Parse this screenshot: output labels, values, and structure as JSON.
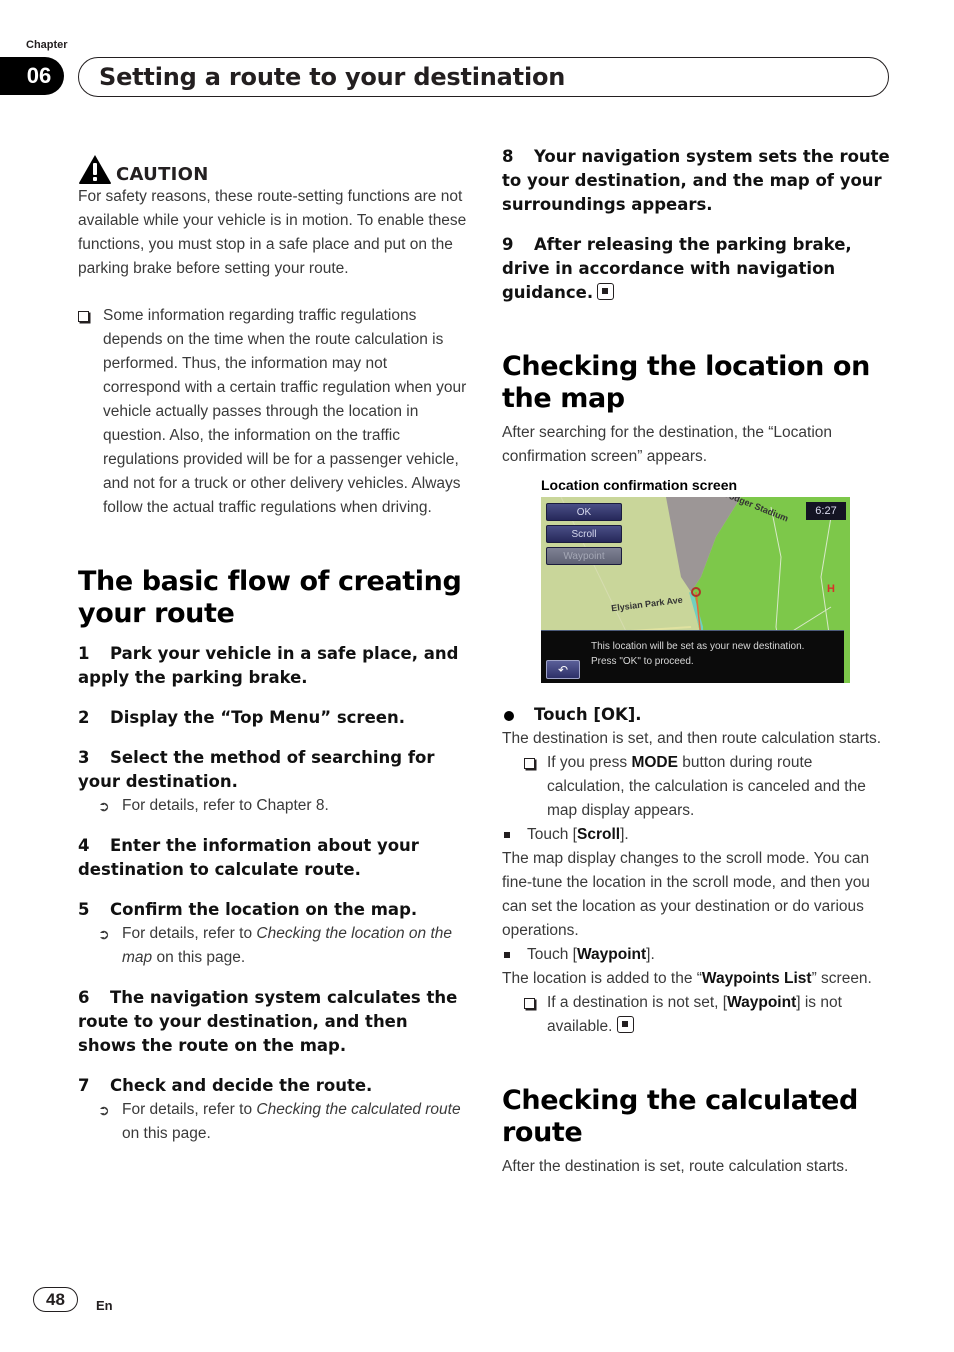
{
  "header": {
    "chapter_label": "Chapter",
    "chapter_number": "06",
    "chapter_title": "Setting a route to your destination"
  },
  "caution": {
    "icon": "warning-triangle-icon",
    "label": "CAUTION",
    "text": "For safety reasons, these route-setting functions are not available while your vehicle is in motion. To enable these functions, you must stop in a safe place and put on the parking brake before setting your route."
  },
  "traffic_note": "Some information regarding traffic regulations depends on the time when the route calculation is performed. Thus, the information may not correspond with a certain traffic regulation when your vehicle actually passes through the location in question. Also, the information on the traffic regulations provided will be for a passenger vehicle, and not for a truck or other delivery vehicles. Always follow the actual traffic regulations when driving.",
  "basic_flow": {
    "heading": "The basic flow of creating your route",
    "steps": [
      {
        "num": "1",
        "text": "Park your vehicle in a safe place, and apply the parking brake."
      },
      {
        "num": "2",
        "text": "Display the “Top Menu” screen."
      },
      {
        "num": "3",
        "text": "Select the method of searching for your destination.",
        "ref": "For details, refer to Chapter 8."
      },
      {
        "num": "4",
        "text": "Enter the information about your destination to calculate route."
      },
      {
        "num": "5",
        "text": "Confirm the location on the map.",
        "ref_prefix": "For details, refer to ",
        "ref_italic": "Checking the location on the map",
        "ref_suffix": " on this page."
      },
      {
        "num": "6",
        "text": "The navigation system calculates the route to your destination, and then shows the route on the map."
      },
      {
        "num": "7",
        "text": "Check and decide the route.",
        "ref_prefix": "For details, refer to ",
        "ref_italic": "Checking the calculated route",
        "ref_suffix": " on this page."
      },
      {
        "num": "8",
        "text": "Your navigation system sets the route to your destination, and the map of your surroundings appears."
      },
      {
        "num": "9",
        "text": "After releasing the parking brake, drive in accordance with navigation guidance."
      }
    ]
  },
  "check_location": {
    "heading": "Checking the location on the map",
    "intro": "After searching for the destination, the “Location confirmation screen” appears.",
    "figure_caption": "Location confirmation screen",
    "screen": {
      "buttons": [
        "OK",
        "Scroll",
        "Waypoint"
      ],
      "clock": "6:27",
      "street": "Elysian Park Ave",
      "landmark": "Dodger Stadium",
      "message_line1": "This location will be set as your new destination.",
      "message_line2": "Press \"OK\" to proceed.",
      "back_icon": "back-arrow-icon"
    },
    "touch_ok": {
      "label": "Touch [OK].",
      "result": "The destination is set, and then route calculation starts.",
      "note_prefix": "If you press ",
      "note_bold": "MODE",
      "note_suffix": " button during route calculation, the calculation is canceled and the map display appears."
    },
    "touch_scroll": {
      "prefix": "Touch [",
      "bold": "Scroll",
      "suffix": "].",
      "result": "The map display changes to the scroll mode. You can fine-tune the location in the scroll mode, and then you can set the location as your destination or do various operations."
    },
    "touch_waypoint": {
      "prefix": "Touch [",
      "bold": "Waypoint",
      "suffix": "].",
      "result_prefix": "The location is added to the “",
      "result_bold": "Waypoints List",
      "result_suffix": "” screen.",
      "note_prefix": "If a destination is not set, [",
      "note_bold": "Waypoint",
      "note_suffix": "] is not available."
    }
  },
  "calculated_route": {
    "heading": "Checking the calculated route",
    "intro": "After the destination is set, route calculation starts."
  },
  "footer": {
    "page_number": "48",
    "language": "En"
  },
  "colors": {
    "map_green": "#7dc84a",
    "map_tan": "#c9d69a",
    "map_gray": "#9c9696",
    "button_navy": "#2f3268"
  }
}
